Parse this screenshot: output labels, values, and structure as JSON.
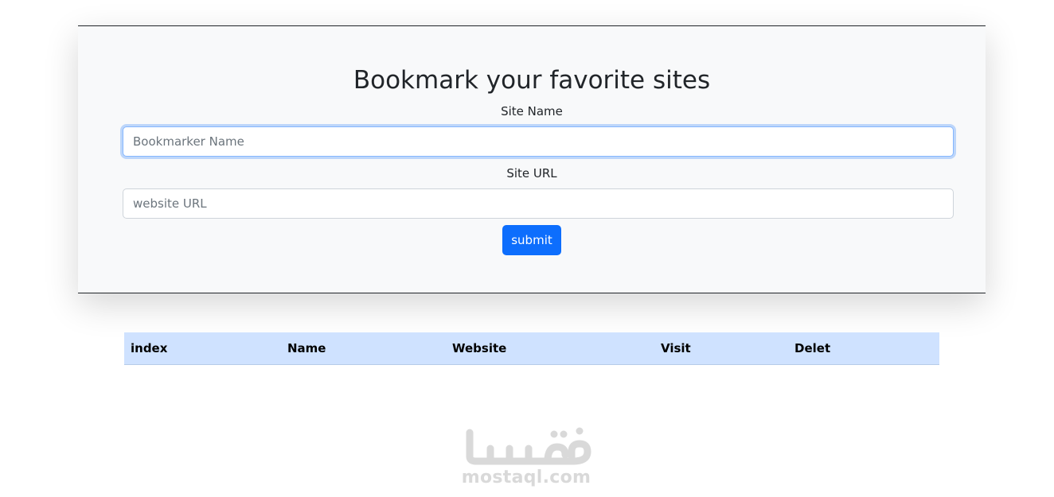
{
  "form": {
    "title": "Bookmark your favorite sites",
    "site_name_label": "Site Name",
    "site_name_placeholder": "Bookmarker Name",
    "site_url_label": "Site URL",
    "site_url_placeholder": "website URL",
    "submit_label": "submit"
  },
  "table": {
    "columns": [
      "index",
      "Name",
      "Website",
      "Visit",
      "Delet"
    ],
    "rows": []
  },
  "watermark": {
    "logo_text": "مستقل",
    "domain_text": "mostaql.com"
  },
  "colors": {
    "accent": "#0d6efd",
    "table_header_bg": "#cfe2ff",
    "card_bg": "#f8f9fa"
  }
}
